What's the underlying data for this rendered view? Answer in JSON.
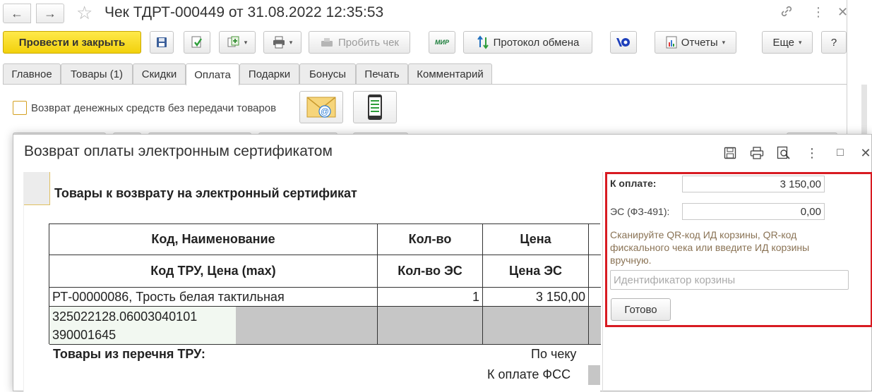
{
  "window": {
    "title": "Чек ТДРТ-000449 от 31.08.2022 12:35:53",
    "nav_back": "←",
    "nav_forward": "→",
    "favorite_glyph": "☆",
    "link_glyph": "🔗",
    "menu_glyph": "⋮",
    "maximize_glyph": "□",
    "close_glyph": "✕"
  },
  "toolbar": {
    "post_close": "Провести и закрыть",
    "print_check": "Пробить чек",
    "mir_logo": "МИР",
    "exchange_log": "Протокол обмена",
    "reports": "Отчеты",
    "more": "Еще",
    "help": "?",
    "caret": "▾",
    "accent_color": "#f5d90f"
  },
  "tabs": [
    {
      "label": "Главное"
    },
    {
      "label": "Товары (1)"
    },
    {
      "label": "Скидки"
    },
    {
      "label": "Оплата",
      "active": true
    },
    {
      "label": "Подарки"
    },
    {
      "label": "Бонусы"
    },
    {
      "label": "Печать"
    },
    {
      "label": "Комментарий"
    }
  ],
  "payment_tab": {
    "refund_checkbox_label": "Возврат денежных средств без передачи товаров",
    "refund_checked": false,
    "email_glyph": "@"
  },
  "dialog": {
    "title": "Возврат оплаты электронным сертификатом",
    "report": {
      "caption": "Товары к возврату на электронный сертификат",
      "header_row1": [
        "Код, Наименование",
        "Кол-во",
        "Цена"
      ],
      "header_row2": [
        "Код ТРУ, Цена (max)",
        "Кол-во ЭС",
        "Цена ЭС"
      ],
      "rows": [
        {
          "name": "РТ-00000086, Трость белая тактильная",
          "qty": "1",
          "price": "3 150,00",
          "tru_code_line1": "325022128.06003040101",
          "tru_code_line2": "390001645"
        }
      ],
      "footer_left": "Товары из перечня ТРУ:",
      "footer_by_check": "По чеку",
      "footer_fss": "К оплате ФСС"
    },
    "panel": {
      "to_pay_label": "К оплате:",
      "to_pay_value": "3 150,00",
      "es_label": "ЭС (ФЗ-491):",
      "es_value": "0,00",
      "hint": "Сканируйте QR-код ИД корзины, QR-код фискального чека или введите ИД корзины вручную.",
      "cart_id_placeholder": "Идентификатор корзины",
      "done_button": "Готово",
      "highlight_color": "#d81b22"
    }
  }
}
